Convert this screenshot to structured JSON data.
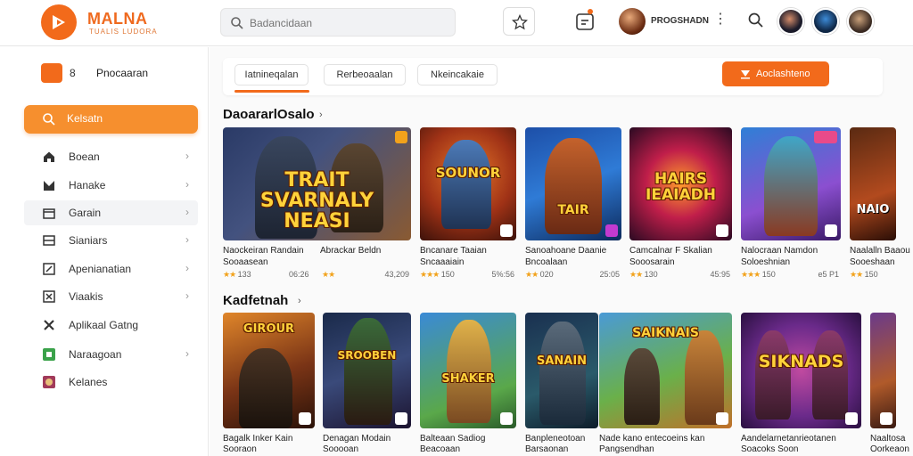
{
  "header": {
    "brand": "MALNA",
    "brand_sub": "TUALIS LUDORA",
    "search_placeholder": "Badancidaan",
    "user_name": "PROGSHADN",
    "kebab": "⋮"
  },
  "sidebar": {
    "head_small": "8",
    "head_title": "Pnocaaran",
    "cta_label": "Kelsatn",
    "items": [
      {
        "label": "Boean",
        "icon": "home-icon",
        "chevron": "›"
      },
      {
        "label": "Hanake",
        "icon": "gamepad-icon",
        "chevron": "›"
      },
      {
        "label": "Garain",
        "icon": "folder-icon",
        "chevron": "›"
      },
      {
        "label": "Sianiars",
        "icon": "list-icon",
        "chevron": "›"
      },
      {
        "label": "Apenianatian",
        "icon": "edit-icon",
        "chevron": "›"
      },
      {
        "label": "Viaakis",
        "icon": "grid-icon",
        "chevron": "›"
      },
      {
        "label": "Aplikaal Gatng",
        "icon": "cross-icon",
        "chevron": ""
      },
      {
        "label": "Naraagoan",
        "icon": "android-icon",
        "chevron": "›"
      },
      {
        "label": "Kelanes",
        "icon": "app-icon",
        "chevron": ""
      }
    ]
  },
  "main": {
    "tabs": [
      "Iatnineqalan",
      "Rerbeoaalan",
      "Nkeincakaie"
    ],
    "install_label": "Aoclashteno",
    "section1": {
      "title": "DaoararlOsalo",
      "arrow": "›",
      "cards": [
        {
          "art": "TRAIT SVARNALY NEASI",
          "name": "Naockeiran Randain",
          "sub": "Sooaasean",
          "rating": "133",
          "size": "06:26",
          "name2": "Abrackar Beldn",
          "sub2": "",
          "rating2": "",
          "size2": "43,209"
        },
        {
          "art": "SOUNOR",
          "name": "Bncanare Taaian",
          "sub": "Sncaaaiain",
          "rating": "150",
          "size": "5%:56"
        },
        {
          "art": "TAIR",
          "name": "Sanoahoane Daanie",
          "sub": "Bncoalaan",
          "rating": "020",
          "size": "25:05"
        },
        {
          "art": "HAIRS IEAIADH",
          "name": "Camcalnar F Skalian",
          "sub": "Sooosarain",
          "rating": "130",
          "size": "45:95"
        },
        {
          "art": "",
          "name": "Nalocraan Namdon",
          "sub": "Soloeshnian",
          "rating": "150",
          "size": "e5 P1"
        },
        {
          "art": "NAIO",
          "name": "Naalalln Baaou",
          "sub": "Sooeshaan",
          "rating": "150",
          "size": ""
        }
      ]
    },
    "section2": {
      "title": "Kadfetnah",
      "arrow": "›",
      "cards": [
        {
          "art": "GIROUR",
          "name": "Bagalk Inker Kain",
          "sub": "Sooraon"
        },
        {
          "art": "SROOBEN",
          "name": "Denagan Modain",
          "sub": "Sooooan"
        },
        {
          "art": "SHAKER",
          "name": "Balteaan Sadiog",
          "sub": "Beacoaan"
        },
        {
          "art": "SANAIN",
          "name": "Banpleneotoan",
          "sub": "Barsaonan"
        },
        {
          "art": "SAIKNAIS",
          "name": "Nade kano entecoeins kan",
          "sub": "Pangsendhan"
        },
        {
          "art": "SIKNADS",
          "name": "Aandelarnetanrieotanen",
          "sub": "Soacoks Soon"
        },
        {
          "art": "",
          "name": "Naaltosa",
          "sub": "Oorkeaon"
        }
      ]
    }
  },
  "colors": {
    "accent": "#f26a1b",
    "cta": "#f68f2e",
    "star": "#f2a21b"
  }
}
